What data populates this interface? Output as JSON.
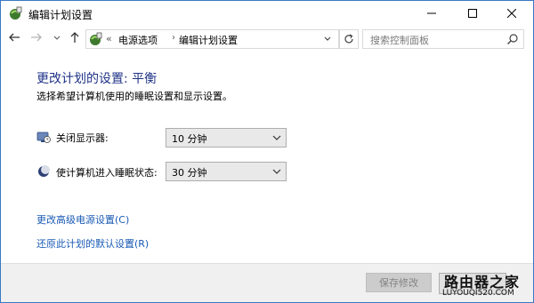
{
  "window": {
    "title": "编辑计划设置",
    "app_icon": "power-options-icon",
    "controls": [
      "minimize-icon",
      "maximize-icon",
      "close-icon"
    ]
  },
  "navigation": {
    "back_icon": "back-arrow-icon",
    "forward_icon": "forward-arrow-icon",
    "up_icon": "up-arrow-icon",
    "breadcrumb_prefix": "«",
    "breadcrumbs": [
      "电源选项",
      "编辑计划设置"
    ],
    "breadcrumb_separator": "›",
    "refresh_icon": "refresh-icon",
    "search_placeholder": "搜索控制面板"
  },
  "content": {
    "heading": "更改计划的设置: 平衡",
    "subtext": "选择希望计算机使用的睡眠设置和显示设置。",
    "settings": [
      {
        "label": "关闭显示器:",
        "value": "10 分钟",
        "icon": "monitor-clock-icon"
      },
      {
        "label": "使计算机进入睡眠状态:",
        "value": "30 分钟",
        "icon": "moon-icon"
      }
    ],
    "links": {
      "advanced": "更改高级电源设置(C)",
      "restore": "还原此计划的默认设置(R)"
    }
  },
  "footer": {
    "save_label": "保存修改"
  },
  "watermark": {
    "top": "路由器之家",
    "bottom": "LUYOUQI520.COM"
  },
  "colors": {
    "heading": "#1e3287",
    "link": "#1a5ab4",
    "window_border": "#3a78c4",
    "footer_bg": "#f0f0f0"
  }
}
